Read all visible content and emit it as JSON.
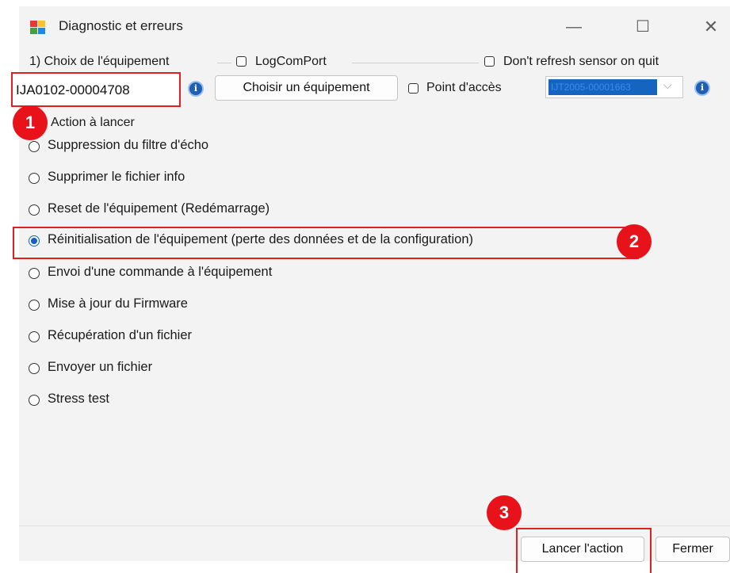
{
  "window": {
    "title": "Diagnostic et erreurs",
    "controls": {
      "minimize": "—",
      "maximize": "☐",
      "close": "✕"
    }
  },
  "equipment": {
    "group_label": "1) Choix de l'équipement",
    "logcomport_label": "LogComPort",
    "dont_refresh_label": "Don't refresh sensor on quit",
    "device_id": "IJA0102-00004708",
    "choose_button": "Choisir un équipement",
    "access_point_label": "Point d'accès",
    "access_point_value": "IJT2005-00001663"
  },
  "actions": {
    "group_label": "Action à lancer",
    "items": [
      {
        "label": "Suppression du filtre d'écho",
        "checked": false
      },
      {
        "label": "Supprimer le fichier info",
        "checked": false
      },
      {
        "label": "Reset de l'équipement (Redémarrage)",
        "checked": false
      },
      {
        "label": "Réinitialisation de l'équipement (perte des données et de la configuration)",
        "checked": true
      },
      {
        "label": "Envoi d'une commande à l'équipement",
        "checked": false
      },
      {
        "label": "Mise à jour du Firmware",
        "checked": false
      },
      {
        "label": "Récupération d'un fichier",
        "checked": false
      },
      {
        "label": "Envoyer un fichier",
        "checked": false
      },
      {
        "label": "Stress test",
        "checked": false
      }
    ]
  },
  "footer": {
    "run_button": "Lancer l'action",
    "close_button": "Fermer"
  },
  "annotations": {
    "badge1": "1",
    "badge2": "2",
    "badge3": "3",
    "badge_color": "#e8121b",
    "highlight_color": "#e02020"
  },
  "colors": {
    "window_bg": "#f3f3f3",
    "accent": "#1560c4"
  }
}
